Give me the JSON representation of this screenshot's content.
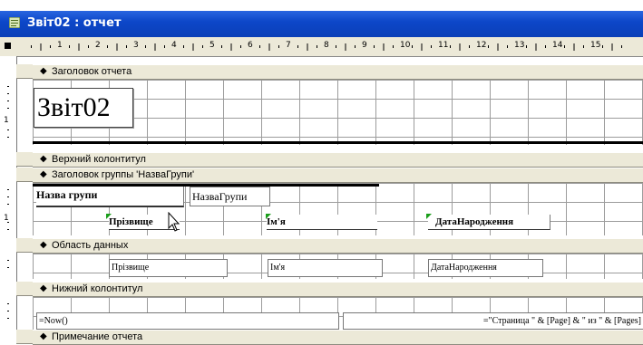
{
  "window": {
    "title": "Звіт02 : отчет",
    "icon": "report-icon"
  },
  "ruler": {
    "numbers": [
      "1",
      "2",
      "3",
      "4",
      "5",
      "6",
      "7",
      "8",
      "9",
      "10",
      "11",
      "12",
      "13",
      "14",
      "15"
    ]
  },
  "vertical_ruler": {
    "numbers": [
      "1",
      "1"
    ]
  },
  "sections": {
    "report_header": "Заголовок отчета",
    "page_header": "Верхний колонтитул",
    "group_header": "Заголовок группы 'НазваГрупи'",
    "detail": "Область данных",
    "page_footer": "Нижний колонтитул",
    "report_footer": "Примечание отчета"
  },
  "controls": {
    "title_label": "Звіт02",
    "group_label": "Назва групи",
    "group_field": "НазваГрупи",
    "surname_label": "Прізвище",
    "name_label": "Ім'я",
    "birth_label": "ДатаНародження",
    "surname_field": "Прізвище",
    "name_field": "Ім'я",
    "birth_field": "ДатаНародження",
    "now_field": "=Now()",
    "page_field": "=\"Страница \" & [Page] & \" из \" & [Pages]"
  },
  "colors": {
    "titlebar": "#0a3fb8",
    "band": "#ece9d8",
    "marker": "#1a9e1a"
  }
}
